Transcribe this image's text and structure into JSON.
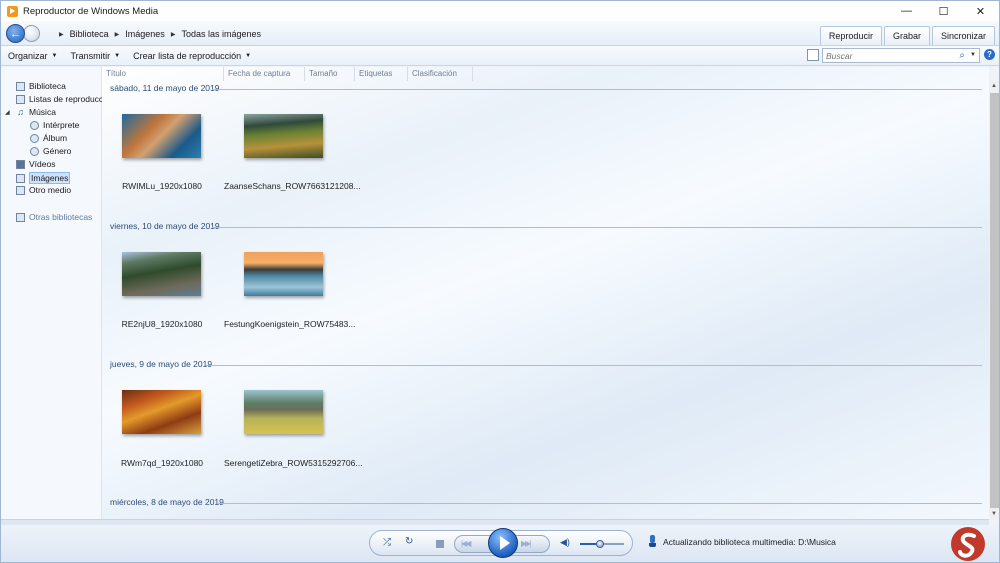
{
  "window": {
    "title": "Reproductor de Windows Media",
    "controls": {
      "minimize": "—",
      "maximize": "☐",
      "close": "✕"
    }
  },
  "nav": {
    "breadcrumb": [
      "Biblioteca",
      "Imágenes",
      "Todas las imágenes"
    ],
    "buttons": [
      "Reproducir",
      "Grabar",
      "Sincronizar"
    ]
  },
  "toolbar": {
    "items": [
      "Organizar",
      "Transmitir",
      "Crear lista de reproducción"
    ],
    "search_placeholder": "Buscar"
  },
  "sidebar": {
    "items": [
      {
        "label": "Biblioteca",
        "icon": "library-icon"
      },
      {
        "label": "Listas de reproducción",
        "icon": "playlist-icon"
      },
      {
        "label": "Música",
        "icon": "music-note-icon"
      },
      {
        "label": "Intérprete",
        "icon": "artist-icon"
      },
      {
        "label": "Álbum",
        "icon": "album-icon"
      },
      {
        "label": "Género",
        "icon": "genre-icon"
      },
      {
        "label": "Vídeos",
        "icon": "video-icon"
      },
      {
        "label": "Imágenes",
        "icon": "pictures-icon"
      },
      {
        "label": "Otro medio",
        "icon": "other-media-icon"
      },
      {
        "label": "Otras bibliotecas",
        "icon": "other-libraries-icon"
      }
    ],
    "selected": "Imágenes"
  },
  "columns": [
    "Título",
    "Fecha de captura",
    "Tamaño",
    "Etiquetas",
    "Clasificación"
  ],
  "groups": [
    {
      "date": "sábado, 11 de mayo de 2019",
      "items": [
        "RWIMLu_1920x1080",
        "ZaanseSchans_ROW7663121208..."
      ]
    },
    {
      "date": "viernes, 10 de mayo de 2019",
      "items": [
        "RE2njU8_1920x1080",
        "FestungKoenigstein_ROW75483..."
      ]
    },
    {
      "date": "jueves, 9 de mayo de 2019",
      "items": [
        "RWm7qd_1920x1080",
        "SerengetiZebra_ROW5315292706..."
      ]
    },
    {
      "date": "miércoles, 8 de mayo de 2019",
      "items": []
    }
  ],
  "player": {
    "volume_level": 0.45,
    "status": "Actualizando biblioteca multimedia: D:\\Musica"
  }
}
